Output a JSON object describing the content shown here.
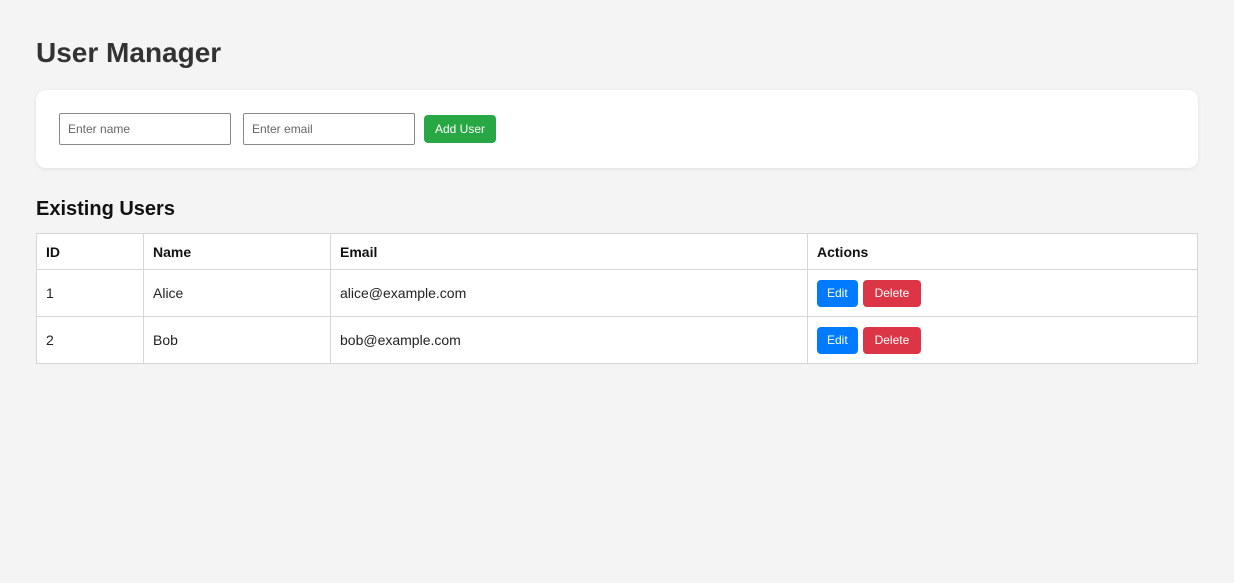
{
  "header": {
    "title": "User Manager"
  },
  "form": {
    "name_placeholder": "Enter name",
    "email_placeholder": "Enter email",
    "add_label": "Add User"
  },
  "section": {
    "title": "Existing Users"
  },
  "table": {
    "headers": [
      "ID",
      "Name",
      "Email",
      "Actions"
    ],
    "rows": [
      {
        "id": "1",
        "name": "Alice",
        "email": "alice@example.com",
        "edit_label": "Edit",
        "delete_label": "Delete"
      },
      {
        "id": "2",
        "name": "Bob",
        "email": "bob@example.com",
        "edit_label": "Edit",
        "delete_label": "Delete"
      }
    ]
  },
  "colors": {
    "add": "#28a745",
    "edit": "#007bff",
    "delete": "#dc3545",
    "background": "#f4f4f4"
  }
}
